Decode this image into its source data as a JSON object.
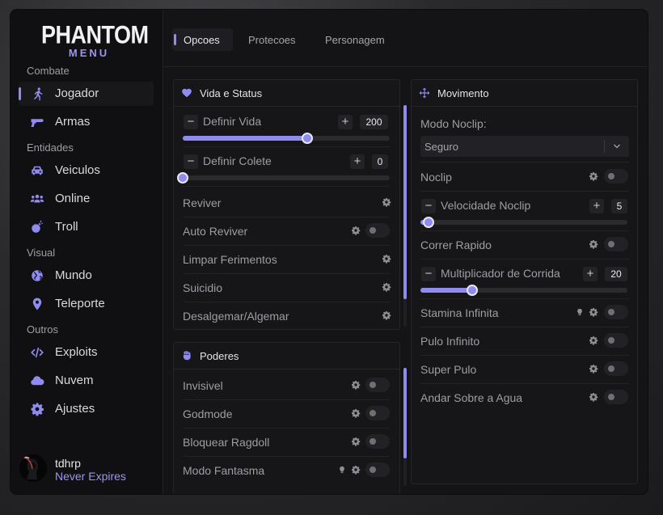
{
  "brand": {
    "name": "PHANTOM",
    "sub": "MENU",
    "accent": "#8f8bf0"
  },
  "sidebar": {
    "sections": [
      {
        "label": "Combate",
        "items": [
          {
            "label": "Jogador",
            "icon": "running-person-icon",
            "active": true
          },
          {
            "label": "Armas",
            "icon": "gun-icon"
          }
        ]
      },
      {
        "label": "Entidades",
        "items": [
          {
            "label": "Veiculos",
            "icon": "car-icon"
          },
          {
            "label": "Online",
            "icon": "users-icon"
          },
          {
            "label": "Troll",
            "icon": "bomb-icon"
          }
        ]
      },
      {
        "label": "Visual",
        "items": [
          {
            "label": "Mundo",
            "icon": "globe-icon"
          },
          {
            "label": "Teleporte",
            "icon": "map-pin-icon"
          }
        ]
      },
      {
        "label": "Outros",
        "items": [
          {
            "label": "Exploits",
            "icon": "code-icon"
          },
          {
            "label": "Nuvem",
            "icon": "cloud-icon"
          },
          {
            "label": "Ajustes",
            "icon": "gear-icon"
          }
        ]
      }
    ]
  },
  "user": {
    "name": "tdhrp",
    "status": "Never Expires"
  },
  "tabs": [
    {
      "label": "Opcoes",
      "active": true
    },
    {
      "label": "Protecoes"
    },
    {
      "label": "Personagem"
    }
  ],
  "vida": {
    "title": "Vida e Status",
    "set_life": {
      "label": "Definir Vida",
      "value": "200",
      "level": 0.6
    },
    "set_armor": {
      "label": "Definir Colete",
      "value": "0",
      "level": 0
    },
    "rows": [
      "Reviver",
      "Auto Reviver",
      "Limpar Ferimentos",
      "Suicidio",
      "Desalgemar/Algemar"
    ]
  },
  "poderes": {
    "title": "Poderes",
    "rows": [
      "Invisivel",
      "Godmode",
      "Bloquear Ragdoll",
      "Modo Fantasma"
    ]
  },
  "movimento": {
    "title": "Movimento",
    "noclip_mode_label": "Modo Noclip:",
    "noclip_mode_value": "Seguro",
    "noclip": "Noclip",
    "noclip_speed": {
      "label": "Velocidade Noclip",
      "value": "5",
      "level": 0.04
    },
    "run_fast": "Correr Rapido",
    "run_mult": {
      "label": "Multiplicador de Corrida",
      "value": "20",
      "level": 0.25
    },
    "rows": [
      "Stamina Infinita",
      "Pulo Infinito",
      "Super Pulo",
      "Andar Sobre a Agua"
    ]
  }
}
